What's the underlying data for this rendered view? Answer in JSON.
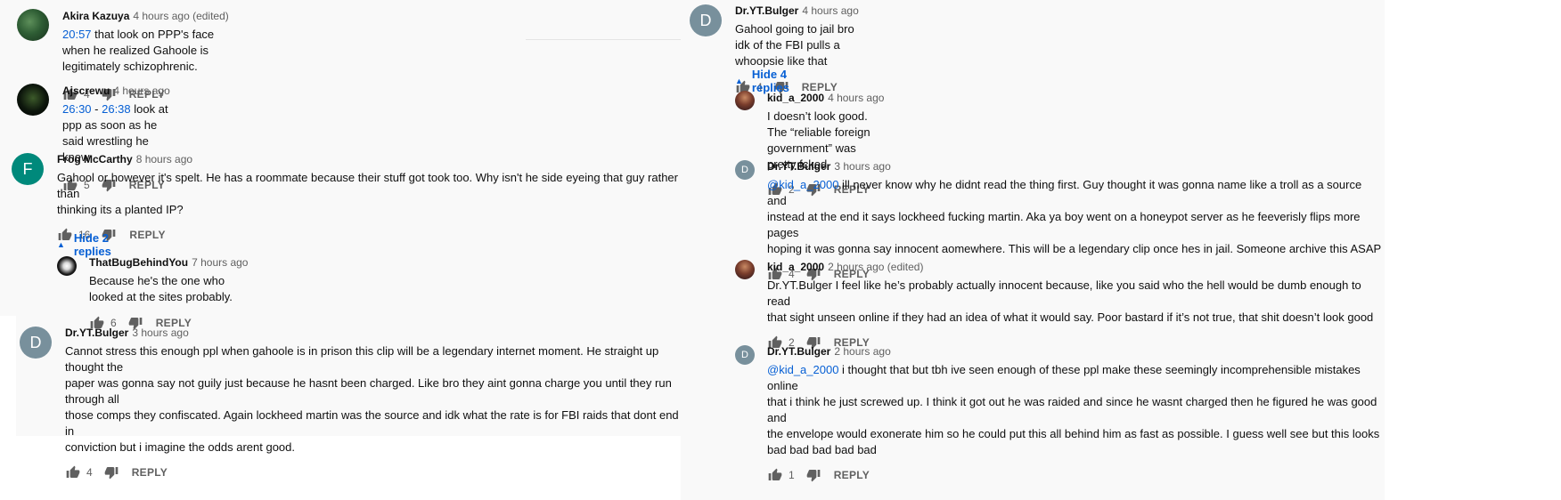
{
  "comments": {
    "akira": {
      "author": "Akira Kazuya",
      "time": "4 hours ago (edited)",
      "ts": "20:57",
      "text": " that look on PPP's face when he realized Gahoole is legitimately schizophrenic.",
      "likes": "4",
      "reply": "REPLY"
    },
    "ajs": {
      "author": "Ajscrewu",
      "time": "4 hours ago",
      "ts1": "26:30",
      "dash": " - ",
      "ts2": "26:38",
      "text": " look at ppp as soon as he said wrestling he knew",
      "likes": "5",
      "reply": "REPLY"
    },
    "frog": {
      "author": "Frog McCarthy",
      "time": "8 hours ago",
      "avatar": "F",
      "text1": "Gahool or however it's spelt. He has a roommate because their stuff got took too. Why isn't he side eyeing that guy rather than",
      "text2": "thinking its a planted IP?",
      "likes": "16",
      "reply": "REPLY",
      "hide_label": "Hide 2 replies"
    },
    "bug": {
      "author": "ThatBugBehindYou",
      "time": "7 hours ago",
      "text": "Because he's the one who looked at the sites probably.",
      "likes": "6",
      "reply": "REPLY"
    },
    "dr_left": {
      "author": "Dr.YT.Bulger",
      "time": "3 hours ago",
      "avatar": "D",
      "lines": [
        "Cannot stress this enough ppl when gahoole is in prison this clip will be a legendary internet moment. He straight up thought the",
        "paper was gonna say not guily just because he hasnt been charged. Like bro they aint gonna charge you until they run through all",
        "those comps they confiscated. Again lockheed martin was the source and idk what the rate is for FBI raids that dont end in",
        "conviction but i imagine the odds arent good."
      ],
      "likes": "4",
      "reply": "REPLY"
    },
    "dr_top": {
      "author": "Dr.YT.Bulger",
      "time": "4 hours ago",
      "avatar": "D",
      "text": "Gahool going to jail bro idk of the FBI pulls a whoopsie like that",
      "likes": "4",
      "reply": "REPLY",
      "hide_label": "Hide 4 replies"
    },
    "kid1": {
      "author": "kid_a_2000",
      "time": "4 hours ago",
      "text": "I doesn’t look good. The “reliable foreign government” was pretty fcked",
      "likes": "2",
      "reply": "REPLY"
    },
    "dr_r1": {
      "author": "Dr.YT.Bulger",
      "time": "3 hours ago",
      "avatar": "D",
      "mention": "@kid_a_2000",
      "line1": " ill never know why he didnt read the thing first. Guy thought it was gonna name like a troll as a source and",
      "lines": [
        "instead at the end it says lockheed fucking martin. Aka ya boy went on a honeypot server as he feeverisly flips more pages",
        "hoping it was gonna say innocent aomewhere. This will be a legendary clip once hes in jail. Someone archive this ASAP"
      ],
      "likes": "4",
      "reply": "REPLY"
    },
    "kid2": {
      "author": "kid_a_2000",
      "time": "2 hours ago (edited)",
      "lines": [
        "Dr.YT.Bulger I feel like he’s probably actually innocent because, like you said who the hell would be dumb enough to read",
        "that sight unseen online if they had an idea of what it would say. Poor bastard if it’s not true, that shit doesn’t look good"
      ],
      "likes": "2",
      "reply": "REPLY"
    },
    "dr_r2": {
      "author": "Dr.YT.Bulger",
      "time": "2 hours ago",
      "avatar": "D",
      "mention": "@kid_a_2000",
      "line1": "  i thought that but tbh ive seen enough of these ppl make these seemingly incomprehensible mistakes online",
      "lines": [
        "that i think he just screwed up. I think it got out he was raided and since he wasnt charged then he figured he was good and",
        "the envelope would exonerate him so he could put this all behind him as fast as possible. I guess well see but this looks",
        "bad bad bad bad bad"
      ],
      "likes": "1",
      "reply": "REPLY"
    }
  },
  "icons": {
    "like": "thumbs-up-icon",
    "dislike": "thumbs-down-icon",
    "collapse": "caret-up-icon"
  },
  "colors": {
    "link": "#065fd4",
    "meta": "#606060",
    "panel": "#f9f9f9"
  }
}
